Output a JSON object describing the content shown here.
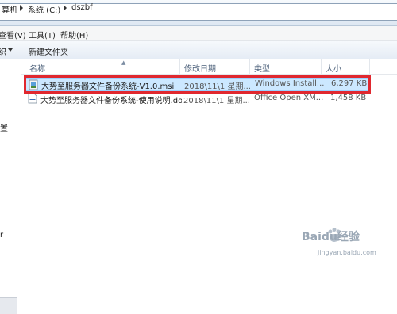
{
  "address": {
    "crumbs": [
      "算机",
      "系统 (C:)",
      "dszbf"
    ]
  },
  "menu": {
    "items": [
      "查看(V)",
      "工具(T)",
      "帮助(H)"
    ]
  },
  "toolbar": {
    "organize_label": "组织",
    "new_folder_label": "新建文件夹"
  },
  "nav": {
    "item_a": "置",
    "item_b": "r"
  },
  "columns": {
    "name": "名称",
    "modified": "修改日期",
    "type": "类型",
    "size": "大小"
  },
  "files": [
    {
      "name": "大势至服务器文件备份系统-V1.0.msi",
      "modified": "2018\\11\\1 星期...",
      "type": "Windows Install...",
      "size": "6,297 KB",
      "icon": "msi-installer-icon",
      "selected": true
    },
    {
      "name": "大势至服务器文件备份系统-使用说明.do...",
      "modified": "2018\\11\\1 星期...",
      "type": "Office Open XM...",
      "size": "1,458 KB",
      "icon": "word-document-icon",
      "selected": false
    }
  ],
  "watermark": {
    "logo_text": "Baidu经验",
    "sub_text": "jingyan.baidu.com"
  },
  "colors": {
    "selection_bg": "#cce8ff",
    "highlight_border": "#e0282f"
  }
}
